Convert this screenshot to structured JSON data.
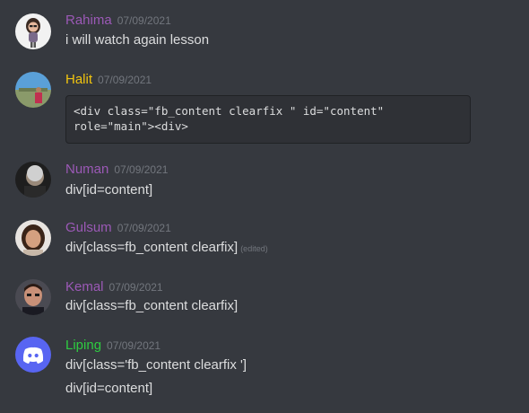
{
  "colors": {
    "background": "#36393f",
    "purple_role": "#9b59b6",
    "gold_role": "#f1c40f",
    "green_role": "#2ecc40",
    "timestamp": "#72767d",
    "text": "#dcddde",
    "discord_blurple": "#5865f2"
  },
  "messages": [
    {
      "username": "Rahima",
      "timestamp": "07/09/2021",
      "avatar_icon": "cartoon-girl-avatar",
      "lines": [
        "i will watch again lesson"
      ]
    },
    {
      "username": "Halit",
      "timestamp": "07/09/2021",
      "avatar_icon": "photo-avatar",
      "code": "<div class=\"fb_content clearfix \" id=\"content\"\nrole=\"main\"><div>"
    },
    {
      "username": "Numan",
      "timestamp": "07/09/2021",
      "avatar_icon": "photo-avatar",
      "lines": [
        "div[id=content]"
      ]
    },
    {
      "username": "Gulsum",
      "timestamp": "07/09/2021",
      "avatar_icon": "photo-avatar",
      "lines": [
        "div[class=fb_content clearfix]"
      ],
      "edited": "(edited)"
    },
    {
      "username": "Kemal",
      "timestamp": "07/09/2021",
      "avatar_icon": "photo-avatar",
      "lines": [
        "div[class=fb_content clearfix]"
      ]
    },
    {
      "username": "Liping",
      "timestamp": "07/09/2021",
      "avatar_icon": "discord-logo-avatar",
      "lines": [
        "div[class='fb_content clearfix ']",
        "div[id=content]"
      ]
    }
  ]
}
